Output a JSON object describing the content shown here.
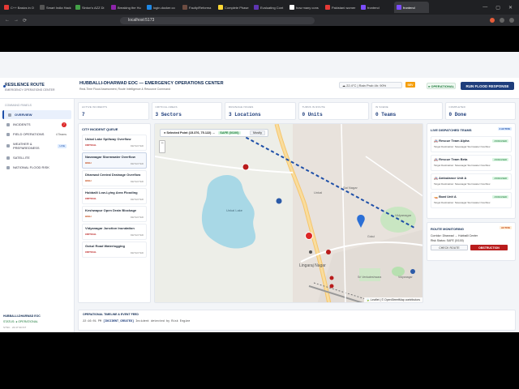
{
  "browser": {
    "tabs": [
      {
        "label": "C++ Basics in O",
        "color": "#e53935"
      },
      {
        "label": "Smart India Hack",
        "color": "#555555"
      },
      {
        "label": "Sinton's AZZ Di",
        "color": "#43a047"
      },
      {
        "label": "Breaking the Hu",
        "color": "#8e24aa"
      },
      {
        "label": "login.docker.co",
        "color": "#1e88e5"
      },
      {
        "label": "Faulty/Reforma",
        "color": "#6d4c41"
      },
      {
        "label": "Complete Phase",
        "color": "#fdd835"
      },
      {
        "label": "Evaluating Cont",
        "color": "#5e35b1"
      },
      {
        "label": "how many cons",
        "color": "#ffffff"
      },
      {
        "label": "Pakistani womer",
        "color": "#e53935"
      },
      {
        "label": "frontend",
        "color": "#7c4dff"
      },
      {
        "label": "frontend",
        "color": "#7c4dff"
      }
    ],
    "active_tab_index": 11,
    "url": "localhost:5173"
  },
  "header": {
    "brand_title": "RESILIENCE ROUTE",
    "brand_sub": "EMERGENCY OPERATIONS CENTER",
    "eoc_title": "HUBBALLI-DHARWAD EOC — EMERGENCY OPERATIONS CENTER",
    "eoc_sub": "Real-Time Flood Assessment, Route Intelligence & Resource Command",
    "weather": "☁ 22.4°C | Rain Prob 4h: 90%",
    "weather_badge": "SEV",
    "operational_label": "● OPERATIONAL",
    "run_button": "RUN FLOOD RESPONSE"
  },
  "sidebar": {
    "section_label": "COMMAND PANELS",
    "items": [
      {
        "label": "OVERVIEW"
      },
      {
        "label": "INCIDENTS",
        "count": "7"
      },
      {
        "label": "FIELD OPERATIONS",
        "meta": "4 Teams"
      },
      {
        "label": "WEATHER & PREPAREDNESS",
        "meta": "LIVE"
      },
      {
        "label": "SATELLITE"
      },
      {
        "label": "NATIONAL FLOOD RISK"
      }
    ],
    "footer_title": "HUBBALLI-DHARWAD EOC",
    "footer_status": "STATUS: ● OPERATIONAL",
    "footer_time": "SYNC · 22:47:30 IST"
  },
  "stats": [
    {
      "label": "ACTIVE INCIDENTS",
      "value": "7"
    },
    {
      "label": "CRITICAL AREAS",
      "value": "3 Sectors"
    },
    {
      "label": "DRAINAGE ISSUES",
      "value": "3 Locations"
    },
    {
      "label": "TURNS IN ROUTE",
      "value": "0 Units"
    },
    {
      "label": "IN SCENE",
      "value": "0 Teams"
    },
    {
      "label": "COMPLETED",
      "value": "0 Done"
    }
  ],
  "incident_queue": {
    "title": "CITY INCIDENT QUEUE",
    "items": [
      {
        "title": "Unkal Lake Spillway Overflow",
        "severity": "CRITICAL",
        "status": "DETECTED"
      },
      {
        "title": "Navanagar Stormwater Overflow",
        "severity": "HIGH",
        "status": "DETECTED"
      },
      {
        "title": "Dharwad Central Drainage Overflow",
        "severity": "HIGH",
        "status": "DETECTED"
      },
      {
        "title": "Hubballi Low-Lying Area Flooding",
        "severity": "CRITICAL",
        "status": "DETECTED"
      },
      {
        "title": "Keshwapur Open Drain Blockage",
        "severity": "HIGH",
        "status": "DETECTED"
      },
      {
        "title": "Vidyanagar Junction Inundation",
        "severity": "CRITICAL",
        "status": "DETECTED"
      },
      {
        "title": "Gokul Road Waterlogging",
        "severity": "CRITICAL",
        "status": "DETECTED"
      }
    ],
    "selected_index": 1
  },
  "map": {
    "selected_point": "● Selected Point (15.376, 75.122) →",
    "safe_label": "SAFE (0/100)",
    "mode_label": "Mostly",
    "zoom_in": "+",
    "zoom_out": "−",
    "places": [
      "Unkal Lake",
      "Unkal",
      "Sai Nagar",
      "Vidyanagar",
      "Lingaraj Nagar",
      "Sri Venkateshwara",
      "Gokul",
      "Vidyanagar"
    ],
    "attribution": "🍃 Leaflet | © OpenStreetMap contributors"
  },
  "teams": {
    "title": "LIVE DISPATCHED TEAMS",
    "count_badge": "4 ACTIVE",
    "items": [
      {
        "name": "🚑 Rescue Team Alpha",
        "dest": "Target Destination: Navanagar Stormwater Overflow",
        "status": "ASSIGNED"
      },
      {
        "name": "🚑 Rescue Team Beta",
        "dest": "Target Destination: Navanagar Stormwater Overflow",
        "status": "ASSIGNED"
      },
      {
        "name": "🚑 Ambulance Unit A",
        "dest": "Target Destination: Navanagar Stormwater Overflow",
        "status": "ASSIGNED"
      },
      {
        "name": "🚤 Boat Unit A",
        "dest": "Target Destination: Navanagar Stormwater Overflow",
        "status": "ASSIGNED"
      }
    ]
  },
  "routes": {
    "title": "ROUTE MONITORING",
    "badge": "ACTIVE",
    "corridor": "Corridor: Dharwad → Hubballi Center",
    "risk": "Risk Status: SAFE (0/100)",
    "check_button": "CHECK ROUTE",
    "obstruction_button": "OBSTRUCTION"
  },
  "timeline": {
    "title": "OPERATIONAL TIMELINE & EVENT FEED",
    "entry_time": "22:16:01 PM",
    "entry_code": "INCIDENT_CREATED",
    "entry_text": "Incident detected by Risk Engine"
  },
  "colors": {
    "primary": "#1e3d7b",
    "critical": "#b91c1c",
    "success": "#1d7a3a",
    "lake": "#a8d8e6"
  }
}
